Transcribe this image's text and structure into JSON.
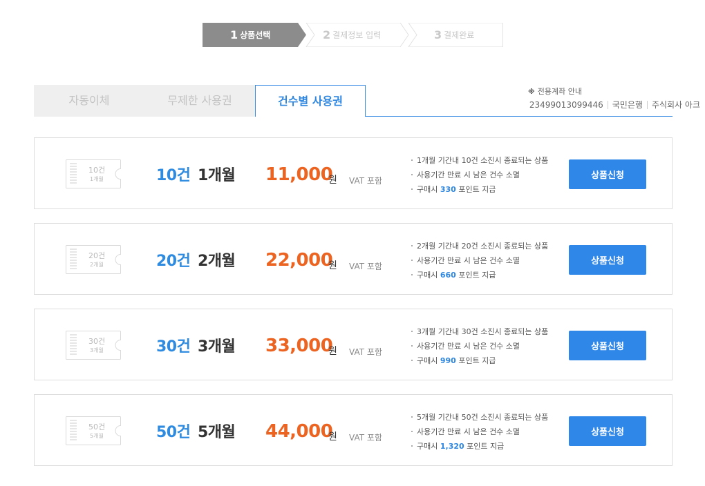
{
  "steps": [
    {
      "num": "1",
      "label": "상품선택",
      "active": true
    },
    {
      "num": "2",
      "label": "결제정보 입력",
      "active": false
    },
    {
      "num": "3",
      "label": "결제완료",
      "active": false
    }
  ],
  "tabs": [
    {
      "label": "자동이체",
      "active": false
    },
    {
      "label": "무제한 사용권",
      "active": false
    },
    {
      "label": "건수별 사용권",
      "active": true
    }
  ],
  "account": {
    "mark": "※",
    "title": "전용계좌 안내",
    "number": "23499013099446",
    "bank": "국민은행",
    "holder": "주식회사 아크"
  },
  "colors": {
    "accent_blue": "#2f87e8",
    "price_orange": "#ec6422",
    "step_active": "#8c8c8c"
  },
  "products": [
    {
      "ticket_count": "10건",
      "ticket_period": "1개월",
      "count": "10건",
      "period": "1개월",
      "price": "11,000",
      "won": "원",
      "vat": "VAT 포함",
      "desc1": "1개월 기간내 10건 소진시 종료되는 상품",
      "desc2": "사용기간 만료 시 남은 건수 소멸",
      "desc3_pre": "구매시 ",
      "points": "330",
      "desc3_post": " 포인트 지급",
      "button": "상품신청"
    },
    {
      "ticket_count": "20건",
      "ticket_period": "2개월",
      "count": "20건",
      "period": "2개월",
      "price": "22,000",
      "won": "원",
      "vat": "VAT 포함",
      "desc1": "2개월 기간내 20건 소진시 종료되는 상품",
      "desc2": "사용기간 만료 시 남은 건수 소멸",
      "desc3_pre": "구매시 ",
      "points": "660",
      "desc3_post": " 포인트 지급",
      "button": "상품신청"
    },
    {
      "ticket_count": "30건",
      "ticket_period": "3개월",
      "count": "30건",
      "period": "3개월",
      "price": "33,000",
      "won": "원",
      "vat": "VAT 포함",
      "desc1": "3개월 기간내 30건 소진시 종료되는 상품",
      "desc2": "사용기간 만료 시 남은 건수 소멸",
      "desc3_pre": "구매시 ",
      "points": "990",
      "desc3_post": " 포인트 지급",
      "button": "상품신청"
    },
    {
      "ticket_count": "50건",
      "ticket_period": "5개월",
      "count": "50건",
      "period": "5개월",
      "price": "44,000",
      "won": "원",
      "vat": "VAT 포함",
      "desc1": "5개월 기간내 50건 소진시 종료되는 상품",
      "desc2": "사용기간 만료 시 남은 건수 소멸",
      "desc3_pre": "구매시 ",
      "points": "1,320",
      "desc3_post": " 포인트 지급",
      "button": "상품신청"
    }
  ]
}
